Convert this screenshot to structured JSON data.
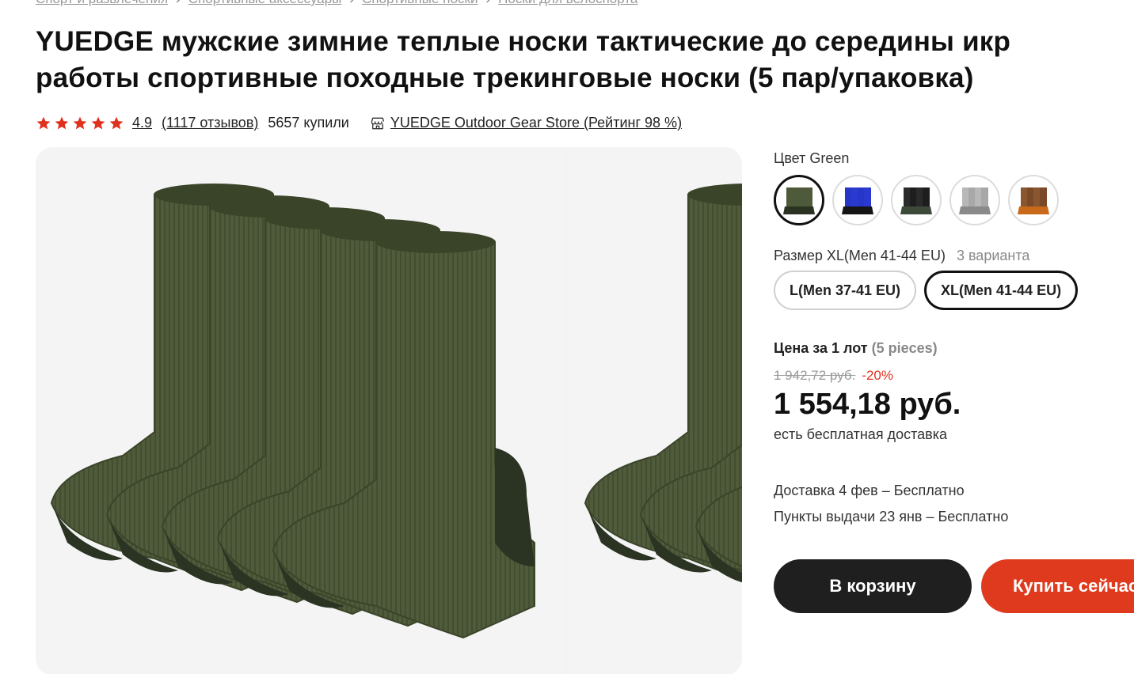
{
  "breadcrumb": {
    "items": [
      "Спорт и развлечения",
      "Спортивные аксессуары",
      "Спортивные носки",
      "Носки для велоспорта"
    ]
  },
  "product": {
    "title_line1": "YUEDGE мужские зимние теплые носки тактические до середины икр",
    "title_line2": "работы спортивные походные трекинговые носки (5 пар/упаковка)",
    "rating": "4.9",
    "rating_value": 4.9,
    "reviews": "(1117 отзывов)",
    "bought": "5657 купили",
    "store": "YUEDGE Outdoor Gear Store (Рейтинг 98 %)"
  },
  "colors": {
    "label": "Цвет Green",
    "options": [
      {
        "name": "Green",
        "color": "#4e5a3a",
        "heel": "#2a3222",
        "selected": true
      },
      {
        "name": "Blue",
        "color": "#2536c8",
        "heel": "#151515",
        "selected": false
      },
      {
        "name": "Black",
        "color": "#2a2a2a",
        "heel": "#3d4a3a",
        "selected": false
      },
      {
        "name": "Grey",
        "color": "#b8b8b8",
        "heel": "#8a8a8a",
        "selected": false
      },
      {
        "name": "Brown",
        "color": "#8a5630",
        "heel": "#c86a1a",
        "selected": false
      }
    ]
  },
  "sizes": {
    "label": "Размер XL(Men 41-44 EU)",
    "variants": "3 варианта",
    "options": [
      {
        "label": "L(Men 37-41 EU)",
        "selected": false
      },
      {
        "label": "XL(Men 41-44 EU)",
        "selected": true
      }
    ]
  },
  "pricing": {
    "label": "Цена за 1 лот",
    "pieces": "(5 pieces)",
    "old_price": "1 942,72 руб.",
    "discount": "-20%",
    "price": "1 554,18 руб.",
    "free_delivery": "есть бесплатная доставка"
  },
  "delivery": {
    "line1": "Доставка 4 фев – Бесплатно",
    "line2": "Пункты выдачи 23 янв – Бесплатно"
  },
  "actions": {
    "cart": "В корзину",
    "buy": "Купить сейчас"
  },
  "theme": {
    "accent": "#e03a1e",
    "dark": "#1f1f1f",
    "star": "#e0301e",
    "sock_green": "#4f5b3b",
    "sock_dark": "#2b3323"
  }
}
